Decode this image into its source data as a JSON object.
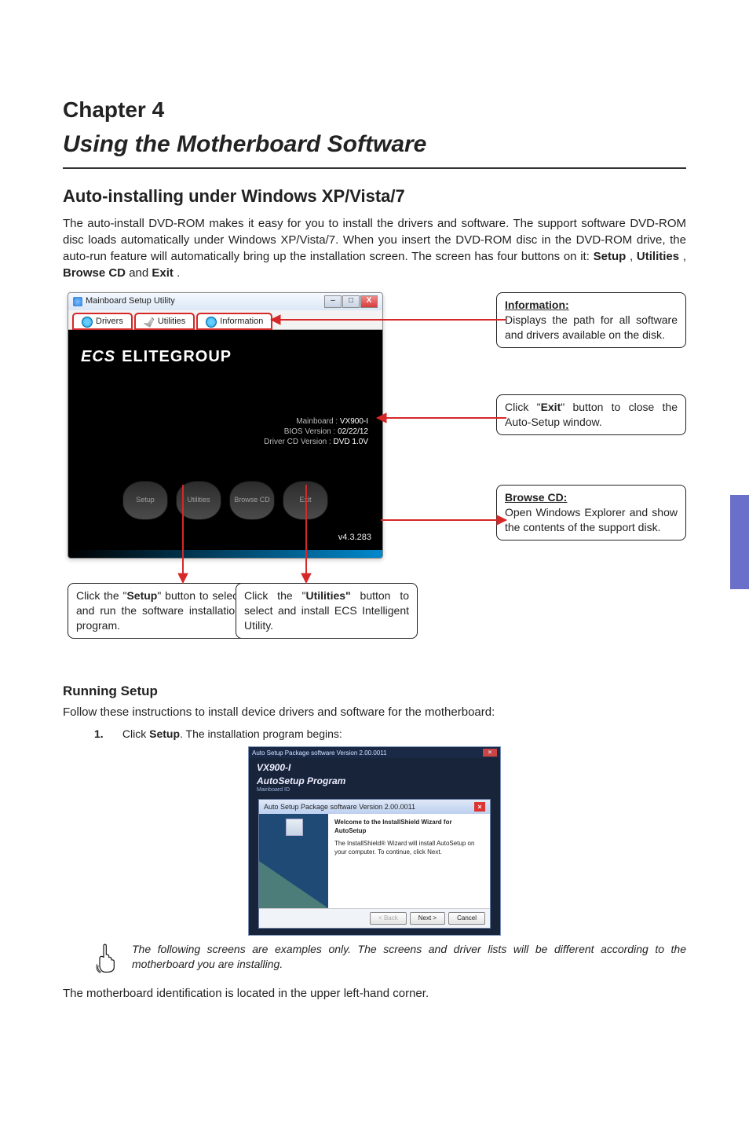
{
  "chapter_label": "Chapter 4",
  "chapter_title": "Using the Motherboard Software",
  "section_heading": "Auto-installing under Windows XP/Vista/7",
  "intro": {
    "p1a": "The auto-install DVD-ROM makes it easy for you to install the drivers and software. The support software DVD-ROM disc loads automatically under Windows XP/Vista/7. When you insert the DVD-ROM disc in the DVD-ROM drive, the auto-run feature will automatically bring up the installation screen. The screen has four buttons on it: ",
    "setup": "Setup",
    "comma1": ", ",
    "utilities": "Utilities",
    "comma2": ", ",
    "browse": "Browse CD",
    "and": " and ",
    "exit": "Exit",
    "period": "."
  },
  "utility_window": {
    "title": "Mainboard Setup Utility",
    "tabs": {
      "drivers": "Drivers",
      "utilities": "Utilities",
      "information": "Information"
    },
    "brand_prefix": "ECS",
    "brand": "ELITEGROUP",
    "mb_info": {
      "mainboard_label": "Mainboard :",
      "mainboard_val": "VX900-I",
      "bios_label": "BIOS Version :",
      "bios_val": "02/22/12",
      "cd_label": "Driver CD Version :",
      "cd_val": "DVD 1.0V"
    },
    "buttons": {
      "setup": "Setup",
      "utilities": "Utilities",
      "browse": "Browse\nCD",
      "exit": "Exit"
    },
    "version": "v4.3.283"
  },
  "callouts": {
    "info_title": "Information:",
    "info_body": "Displays the path for all software and drivers available on the disk.",
    "exit_a": "Click \"",
    "exit_b": "Exit",
    "exit_c": "\" button to close the Auto-Setup window.",
    "browse_title": "Browse CD:",
    "browse_body": "Open Windows Explorer and show the contents of the support disk.",
    "setup_a": "Click the \"",
    "setup_b": "Setup",
    "setup_c": "\" button to select and run the software installation program.",
    "util_a": "Click the \"",
    "util_b": "Utilities\"",
    "util_c": " button to select and install ECS Intelligent Utility."
  },
  "running_heading": "Running Setup",
  "follow_text": "Follow these instructions to install device drivers and software for the motherboard:",
  "step1": {
    "num": "1.",
    "a": "Click ",
    "b": "Setup",
    "c": ". The installation program begins:"
  },
  "installer": {
    "top_title": "Auto Setup Package software Version 2.00.0011",
    "mainboard_id_label": "Mainboard ID",
    "product": "VX900-I",
    "program": "AutoSetup Program",
    "wizard_bar": "Auto Setup Package software Version 2.00.0011",
    "welcome_title": "Welcome to the InstallShield Wizard for AutoSetup",
    "welcome_body": "The InstallShield® Wizard will install AutoSetup on your computer. To continue, click Next.",
    "btn_back": "< Back",
    "btn_next": "Next >",
    "btn_cancel": "Cancel"
  },
  "note": "The following screens are examples only. The screens and driver lists will be different according to the motherboard you are installing.",
  "footer_line": "The motherboard identification is located in the upper left-hand corner."
}
